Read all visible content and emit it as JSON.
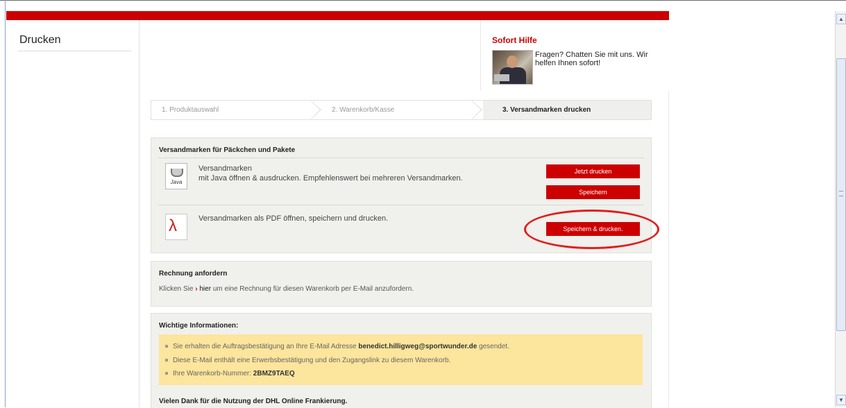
{
  "sidebar": {
    "title": "Drucken"
  },
  "help": {
    "title": "Sofort Hilfe",
    "text": "Fragen? Chatten Sie mit uns. Wir helfen Ihnen sofort!"
  },
  "steps": [
    {
      "label": "1. Produktauswahl",
      "state": "done"
    },
    {
      "label": "2. Warenkorb/Kasse",
      "state": "done"
    },
    {
      "label": "3. Versandmarken drucken",
      "state": "active"
    }
  ],
  "labels_section": {
    "title": "Versandmarken für Päckchen und Pakete",
    "java": {
      "icon": "java-icon",
      "icon_label": "Java",
      "title": "Versandmarken",
      "subtitle": "mit Java öffnen & ausdrucken. Empfehlenswert bei mehreren Versandmarken.",
      "print_button": "Jetzt drucken",
      "save_button": "Speichern"
    },
    "pdf": {
      "icon": "pdf-icon",
      "text": "Versandmarken als PDF öffnen, speichern und drucken.",
      "button": "Speichern & drucken."
    }
  },
  "invoice_section": {
    "title": "Rechnung anfordern",
    "prefix": "Klicken Sie",
    "arrow": "›",
    "link": "hier",
    "suffix": "um eine Rechnung für diesen Warenkorb per E-Mail anzufordern."
  },
  "info_section": {
    "title": "Wichtige Informationen:",
    "item1_prefix": "Sie erhalten die Auftragsbestätigung an Ihre E-Mail Adresse",
    "item1_email": "benedict.hilligweg@sportwunder.de",
    "item1_suffix": "gesendet.",
    "item2": "Diese E-Mail enthält eine Erwerbsbestätigung und den Zugangslink zu diesem Warenkorb.",
    "item3_prefix": "Ihre Warenkorb-Nummer:",
    "item3_number": "2BMZ9TAEQ"
  },
  "thanks": "Vielen Dank für die Nutzung der DHL Online Frankierung.",
  "colors": {
    "brand_red": "#cc0000",
    "info_yellow": "#fce59c",
    "panel_gray": "#f0f0ec"
  }
}
